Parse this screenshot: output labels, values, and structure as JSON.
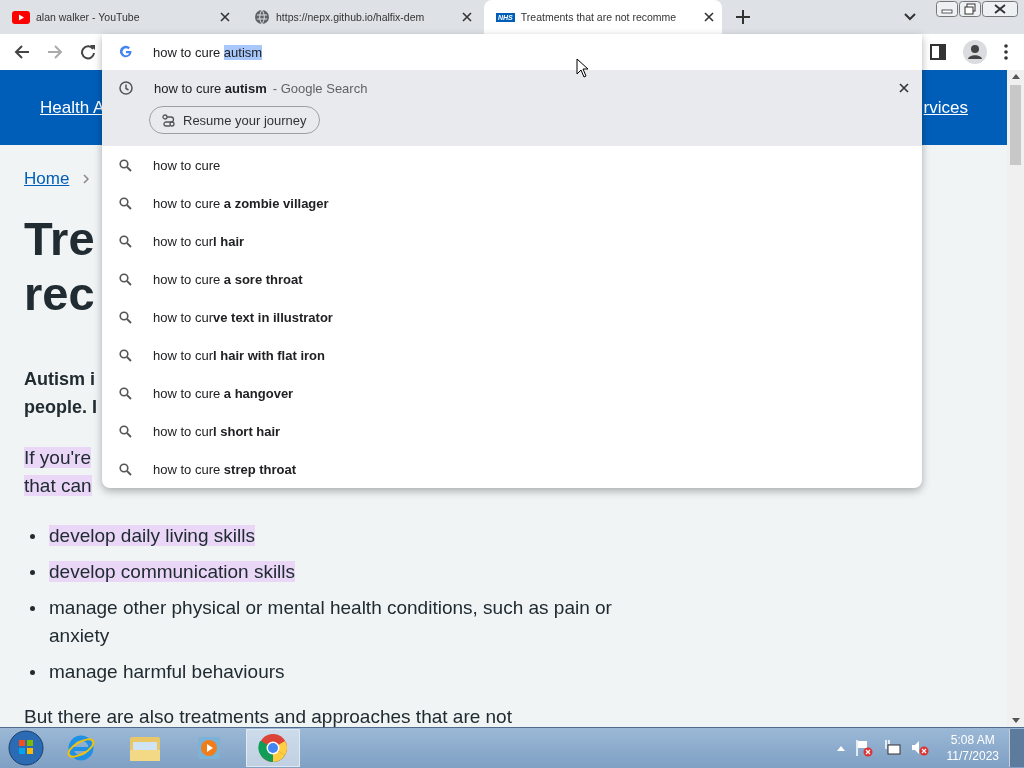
{
  "tabs": [
    {
      "kind": "youtube",
      "title": "alan walker - YouTube",
      "selected": false
    },
    {
      "kind": "globe",
      "title": "https://nepx.github.io/halfix-dem",
      "selected": false
    },
    {
      "kind": "nhs",
      "badge": "NHS",
      "title": "Treatments that are not recomme",
      "selected": true
    }
  ],
  "omnibox": {
    "text": "how to cure ",
    "selection": "autism",
    "top_match": {
      "text": "how to cure **autism**",
      "suffix": "- Google Search",
      "chip": "Resume your journey",
      "selected": true
    },
    "suggestions": [
      {
        "text": "how to cure",
        "selected": false
      },
      {
        "text": "how to cure **a zombie villager**",
        "selected": false
      },
      {
        "text": "how to cur**l hair**",
        "selected": false
      },
      {
        "text": "how to cure **a sore throat**",
        "selected": false
      },
      {
        "text": "how to cur**ve text in illustrator**",
        "selected": false
      },
      {
        "text": "how to cur**l hair with flat iron**",
        "selected": false
      },
      {
        "text": "how to cure **a hangover**",
        "selected": false
      },
      {
        "text": "how to cur**l short hair**",
        "selected": false
      },
      {
        "text": "how to cure **strep throat**",
        "selected": false
      }
    ]
  },
  "page": {
    "nav_left": "Health A",
    "nav_right": "rvices",
    "breadcrumb": "Home",
    "heading_lines": [
      "Tre",
      "rec"
    ],
    "intro_lines": [
      "Autism i",
      "people. I"
    ],
    "para_lines": [
      {
        "text": "If you're",
        "highlighted": true
      },
      {
        "text": "that can",
        "highlighted": true
      }
    ],
    "list": [
      {
        "text": "develop daily living skills",
        "highlighted": true
      },
      {
        "text": "develop communication skills",
        "highlighted": true
      },
      {
        "text": "manage other physical or mental health conditions, such as pain or anxiety",
        "highlighted": false
      },
      {
        "text": "manage harmful behaviours",
        "highlighted": false
      }
    ],
    "cut_line": "But there are also treatments and approaches that are not"
  },
  "taskbar": {
    "apps": [
      {
        "kind": "ie",
        "active": false
      },
      {
        "kind": "explorer",
        "active": false
      },
      {
        "kind": "media",
        "active": false
      },
      {
        "kind": "chrome",
        "active": true
      }
    ],
    "time": "5:08 AM",
    "date": "11/7/2023"
  }
}
